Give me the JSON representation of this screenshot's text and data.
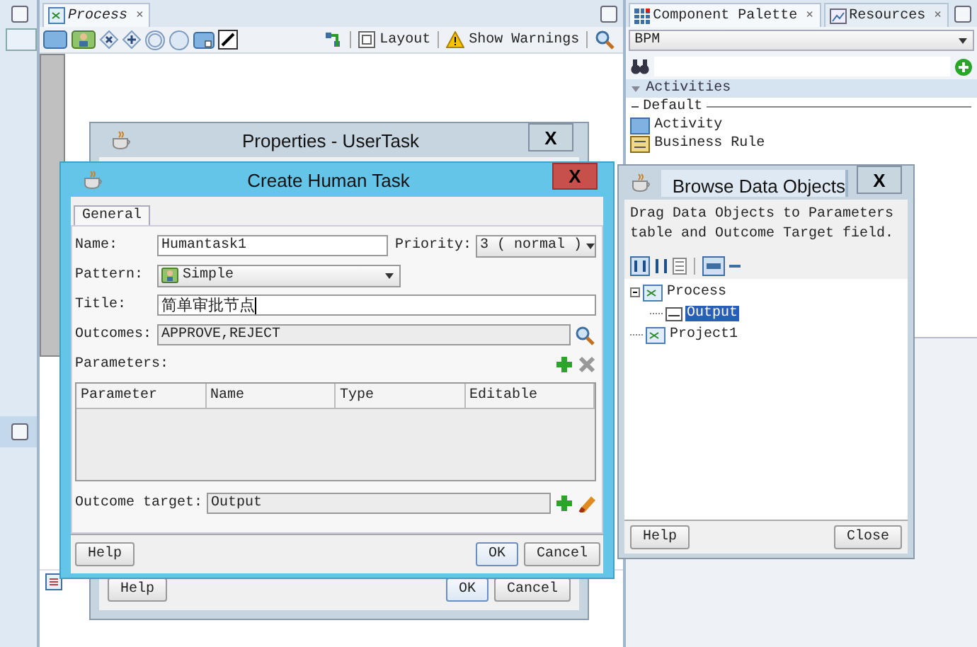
{
  "editor": {
    "tabs": [
      {
        "label": "Process",
        "close": "×",
        "selected": true
      }
    ],
    "toolbar": [
      {
        "kind": "layout",
        "label": "Layout"
      },
      {
        "kind": "warnings",
        "label": "Show Warnings"
      }
    ]
  },
  "palette": {
    "tabs": [
      {
        "label": "Component Palette",
        "close": "×",
        "selected": true
      },
      {
        "label": "Resources",
        "close": "×",
        "selected": false
      }
    ],
    "library": "BPM",
    "section": {
      "label": "Activities",
      "expanded": true
    },
    "group": "Default",
    "items": [
      "Activity",
      "Business Rule"
    ]
  },
  "properties_dialog": {
    "title": "Properties - UserTask",
    "close": "X",
    "buttons": [
      {
        "kind": "help",
        "label": "Help"
      },
      {
        "kind": "ok",
        "label": "OK"
      },
      {
        "kind": "cancel",
        "label": "Cancel"
      }
    ]
  },
  "create_dialog": {
    "title": "Create Human Task",
    "close": "X",
    "tabs": [
      {
        "label": "General",
        "selected": true
      }
    ],
    "name": {
      "label": "Name:",
      "value": "Humantask1"
    },
    "priority": {
      "label": "Priority:",
      "value": "3 ( normal )"
    },
    "pattern": {
      "label": "Pattern:",
      "value": "Simple"
    },
    "title_field": {
      "label": "Title:",
      "value": "简单审批节点"
    },
    "outcomes": {
      "label": "Outcomes:",
      "value": "APPROVE,REJECT"
    },
    "parameters": {
      "label": "Parameters:",
      "columns": [
        "Parameter",
        "Name",
        "Type",
        "Editable"
      ]
    },
    "outcome_target": {
      "label": "Outcome target:",
      "value": "Output"
    },
    "buttons": [
      {
        "kind": "help",
        "label": "Help"
      },
      {
        "kind": "ok",
        "label": "OK"
      },
      {
        "kind": "cancel",
        "label": "Cancel"
      }
    ]
  },
  "browse_dialog": {
    "title": "Browse Data Objects",
    "close": "X",
    "description": "Drag Data Objects to Parameters table and Outcome Target field.",
    "tree": [
      {
        "label": "Process",
        "expanded": true,
        "selected": false,
        "children": [
          {
            "label": "Output",
            "selected": true
          }
        ]
      },
      {
        "label": "Project1",
        "selected": false
      }
    ],
    "buttons": [
      {
        "kind": "help",
        "label": "Help"
      },
      {
        "kind": "close",
        "label": "Close"
      }
    ]
  }
}
